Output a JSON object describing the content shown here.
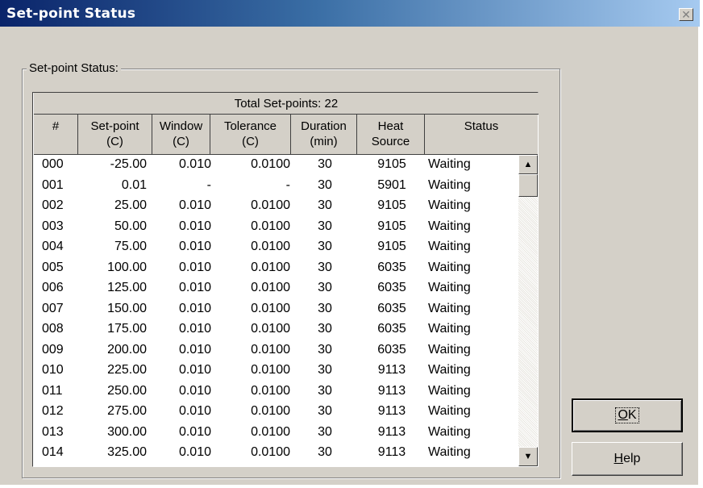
{
  "window": {
    "title": "Set-point Status",
    "close_glyph": "✕"
  },
  "group": {
    "label": "Set-point Status:"
  },
  "table": {
    "total_label": "Total Set-points: 22",
    "columns": [
      "#",
      "Set-point\n(C)",
      "Window\n(C)",
      "Tolerance\n(C)",
      "Duration\n(min)",
      "Heat\nSource",
      "Status"
    ],
    "rows": [
      [
        "000",
        "-25.00",
        "0.010",
        "0.0100",
        "30",
        "9105",
        "Waiting"
      ],
      [
        "001",
        "0.01",
        "-",
        "-",
        "30",
        "5901",
        "Waiting"
      ],
      [
        "002",
        "25.00",
        "0.010",
        "0.0100",
        "30",
        "9105",
        "Waiting"
      ],
      [
        "003",
        "50.00",
        "0.010",
        "0.0100",
        "30",
        "9105",
        "Waiting"
      ],
      [
        "004",
        "75.00",
        "0.010",
        "0.0100",
        "30",
        "9105",
        "Waiting"
      ],
      [
        "005",
        "100.00",
        "0.010",
        "0.0100",
        "30",
        "6035",
        "Waiting"
      ],
      [
        "006",
        "125.00",
        "0.010",
        "0.0100",
        "30",
        "6035",
        "Waiting"
      ],
      [
        "007",
        "150.00",
        "0.010",
        "0.0100",
        "30",
        "6035",
        "Waiting"
      ],
      [
        "008",
        "175.00",
        "0.010",
        "0.0100",
        "30",
        "6035",
        "Waiting"
      ],
      [
        "009",
        "200.00",
        "0.010",
        "0.0100",
        "30",
        "6035",
        "Waiting"
      ],
      [
        "010",
        "225.00",
        "0.010",
        "0.0100",
        "30",
        "9113",
        "Waiting"
      ],
      [
        "011",
        "250.00",
        "0.010",
        "0.0100",
        "30",
        "9113",
        "Waiting"
      ],
      [
        "012",
        "275.00",
        "0.010",
        "0.0100",
        "30",
        "9113",
        "Waiting"
      ],
      [
        "013",
        "300.00",
        "0.010",
        "0.0100",
        "30",
        "9113",
        "Waiting"
      ],
      [
        "014",
        "325.00",
        "0.010",
        "0.0100",
        "30",
        "9113",
        "Waiting"
      ]
    ]
  },
  "scrollbar": {
    "up_glyph": "▲",
    "down_glyph": "▼"
  },
  "buttons": {
    "ok": {
      "mnemonic": "O",
      "rest": "K"
    },
    "help": {
      "mnemonic": "H",
      "rest": "elp"
    }
  }
}
